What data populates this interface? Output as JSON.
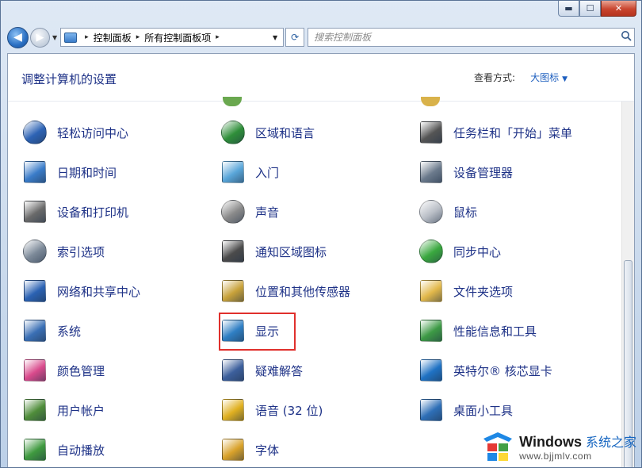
{
  "window": {
    "caption_buttons": {
      "minimize": "▬",
      "maximize": "☐",
      "close": "✕"
    }
  },
  "nav": {
    "back_glyph": "◀",
    "forward_glyph": "▶",
    "history_dropdown_glyph": "▼",
    "breadcrumbs": [
      "控制面板",
      "所有控制面板项"
    ],
    "breadcrumb_separator": "▸",
    "address_dropdown_glyph": "▼",
    "refresh_glyph": "⟳",
    "search": {
      "placeholder": "搜索控制面板",
      "value": ""
    }
  },
  "header": {
    "title": "调整计算机的设置",
    "view_by_label": "查看方式:",
    "view_by_value": "大图标",
    "view_by_caret": "▼"
  },
  "items": [
    {
      "label": "轻松访问中心",
      "icon": "ease-of-access-icon",
      "color": "#2d63b5"
    },
    {
      "label": "区域和语言",
      "icon": "globe-clock-icon",
      "color": "#2f8f3a"
    },
    {
      "label": "任务栏和「开始」菜单",
      "icon": "taskbar-icon",
      "color": "#555555"
    },
    {
      "label": "日期和时间",
      "icon": "calendar-clock-icon",
      "color": "#3a7cc9"
    },
    {
      "label": "入门",
      "icon": "getting-started-icon",
      "color": "#59a6d9"
    },
    {
      "label": "设备管理器",
      "icon": "device-manager-icon",
      "color": "#6b7a8c"
    },
    {
      "label": "设备和打印机",
      "icon": "printer-icon",
      "color": "#6a6a6a"
    },
    {
      "label": "声音",
      "icon": "speaker-icon",
      "color": "#8a8a8a"
    },
    {
      "label": "鼠标",
      "icon": "mouse-icon",
      "color": "#b9bec6"
    },
    {
      "label": "索引选项",
      "icon": "magnifier-icon",
      "color": "#7d8a99"
    },
    {
      "label": "通知区域图标",
      "icon": "notification-area-icon",
      "color": "#4b4b4b"
    },
    {
      "label": "同步中心",
      "icon": "sync-center-icon",
      "color": "#3aa83f"
    },
    {
      "label": "网络和共享中心",
      "icon": "network-icon",
      "color": "#2b62b3"
    },
    {
      "label": "位置和其他传感器",
      "icon": "sensor-icon",
      "color": "#c8a23a"
    },
    {
      "label": "文件夹选项",
      "icon": "folder-options-icon",
      "color": "#e2b84a"
    },
    {
      "label": "系统",
      "icon": "system-monitor-icon",
      "color": "#3a6fb5"
    },
    {
      "label": "显示",
      "icon": "display-icon",
      "color": "#2f7fc4"
    },
    {
      "label": "性能信息和工具",
      "icon": "performance-icon",
      "color": "#3d9a45"
    },
    {
      "label": "颜色管理",
      "icon": "color-management-icon",
      "color": "#d94a8c"
    },
    {
      "label": "疑难解答",
      "icon": "troubleshooting-icon",
      "color": "#3c5f9c"
    },
    {
      "label": "英特尔® 核芯显卡",
      "icon": "intel-graphics-icon",
      "color": "#1f72c4"
    },
    {
      "label": "用户帐户",
      "icon": "user-accounts-icon",
      "color": "#4f8d3a"
    },
    {
      "label": "语音 (32 位)",
      "icon": "speech-icon",
      "color": "#e0b020"
    },
    {
      "label": "桌面小工具",
      "icon": "gadgets-icon",
      "color": "#2e6fb7"
    },
    {
      "label": "自动播放",
      "icon": "autoplay-icon",
      "color": "#3f9a3f"
    },
    {
      "label": "字体",
      "icon": "fonts-icon",
      "color": "#d9a22a"
    }
  ],
  "highlighted_item": "显示",
  "watermark": {
    "brand": "Windows",
    "brand_suffix": "系统之家",
    "url": "www.bjjmlv.com",
    "flag_colors": [
      "#e53935",
      "#43a047",
      "#1e88e5",
      "#fdd835"
    ]
  }
}
